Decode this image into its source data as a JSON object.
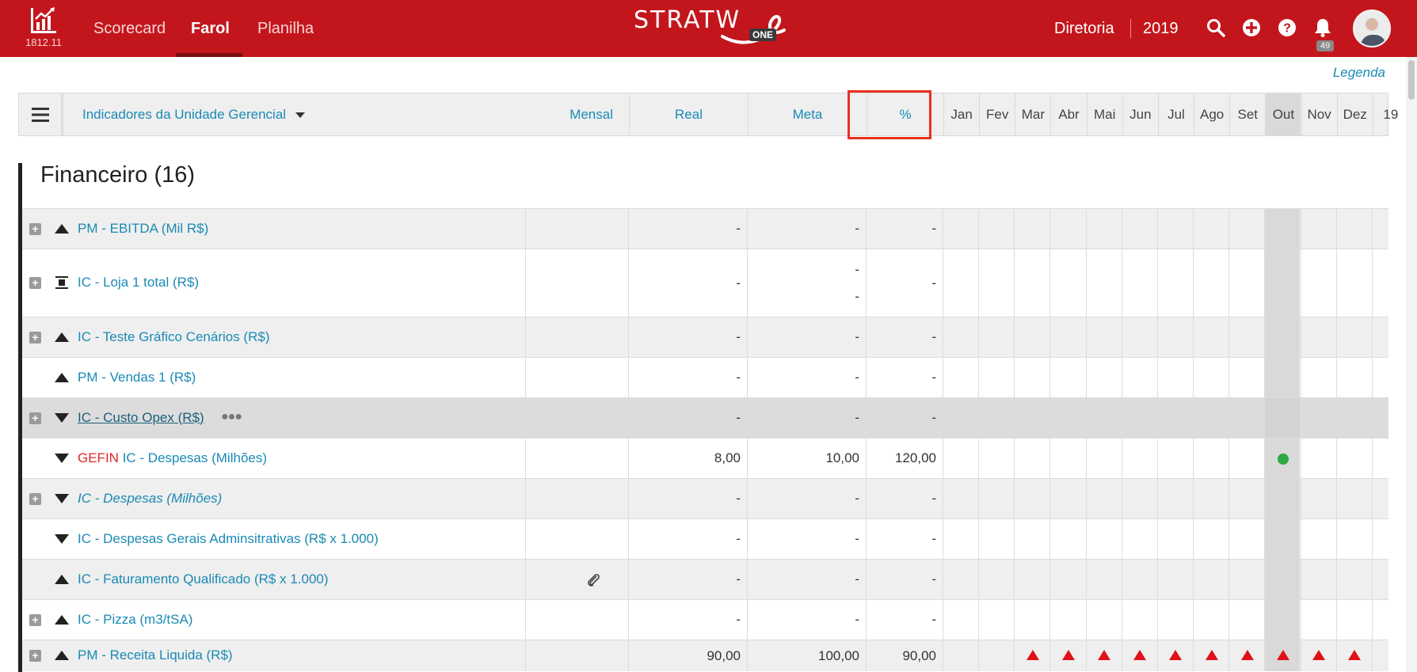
{
  "topbar": {
    "version": "1812.11",
    "nav": [
      "Scorecard",
      "Farol",
      "Planilha"
    ],
    "active_nav": "Farol",
    "brand": "STRATW",
    "brand_badge": "ONE",
    "unit": "Diretoria",
    "year": "2019",
    "notifications": "49",
    "icons": [
      "chart-logo-icon",
      "search-icon",
      "plus-circle-icon",
      "help-circle-icon",
      "bell-icon"
    ]
  },
  "legend_link": "Legenda",
  "header": {
    "selector_label": "Indicadores da Unidade Gerencial",
    "period": "Mensal",
    "real": "Real",
    "meta": "Meta",
    "percent": "%",
    "months": [
      "Jan",
      "Fev",
      "Mar",
      "Abr",
      "Mai",
      "Jun",
      "Jul",
      "Ago",
      "Set",
      "Out",
      "Nov",
      "Dez",
      "19"
    ],
    "current_month": "Out"
  },
  "section": {
    "title": "Financeiro (16)"
  },
  "rows": [
    {
      "expand": true,
      "trend": "up",
      "prefix": "",
      "name": "PM - EBITDA (Mil R$)",
      "real": "-",
      "meta": "-",
      "meta2": "",
      "pct": "-",
      "shade": true
    },
    {
      "expand": true,
      "trend": "flat",
      "prefix": "",
      "name": "IC - Loja 1 total (R$)",
      "real": "-",
      "meta": "-",
      "meta2": "-",
      "pct": "-",
      "shade": false
    },
    {
      "expand": true,
      "trend": "up",
      "prefix": "",
      "name": "IC - Teste Gráfico Cenários (R$)",
      "real": "-",
      "meta": "-",
      "meta2": "",
      "pct": "-",
      "shade": true
    },
    {
      "expand": false,
      "trend": "up",
      "prefix": "",
      "name": "PM - Vendas 1 (R$)",
      "real": "-",
      "meta": "-",
      "meta2": "",
      "pct": "-",
      "shade": false
    },
    {
      "expand": true,
      "trend": "down",
      "prefix": "",
      "name": "IC - Custo Opex (R$) ",
      "real": "-",
      "meta": "-",
      "meta2": "",
      "pct": "-",
      "shade": "dark"
    },
    {
      "expand": false,
      "trend": "down",
      "prefix": "GEFIN",
      "name": "IC - Despesas (Milhões)",
      "real": "8,00",
      "meta": "10,00",
      "meta2": "",
      "pct": "120,00",
      "shade": false,
      "status_out": "green"
    },
    {
      "expand": true,
      "trend": "down",
      "prefix": "",
      "name": "IC - Despesas (Milhões)",
      "real": "-",
      "meta": "-",
      "meta2": "",
      "pct": "-",
      "shade": true,
      "italic": true
    },
    {
      "expand": false,
      "trend": "down",
      "prefix": "",
      "name": "IC - Despesas Gerais Adminsitrativas (R$ x 1.000)",
      "real": "-",
      "meta": "-",
      "meta2": "",
      "pct": "-",
      "shade": false
    },
    {
      "expand": false,
      "trend": "up",
      "prefix": "",
      "name": "IC - Faturamento Qualificado (R$ x 1.000)",
      "real": "-",
      "meta": "-",
      "meta2": "",
      "pct": "-",
      "shade": true,
      "attachment": true
    },
    {
      "expand": true,
      "trend": "up",
      "prefix": "",
      "name": "IC - Pizza (m3/tSA)",
      "real": "-",
      "meta": "-",
      "meta2": "",
      "pct": "-",
      "shade": false
    },
    {
      "expand": true,
      "trend": "up",
      "prefix": "",
      "name": "PM - Receita Liquida (R$)",
      "real": "90,00",
      "meta": "100,00",
      "meta2": "",
      "pct": "90,00",
      "shade": true,
      "red_triangles_months": [
        "Mar",
        "Abr",
        "Mai",
        "Jun",
        "Jul",
        "Ago",
        "Set",
        "Out",
        "Nov",
        "Dez"
      ]
    }
  ],
  "colors": {
    "topbar": "#c3161c",
    "link": "#1a8ab5",
    "highlight_box": "#e8301f",
    "status_green": "#2ea845",
    "status_red": "#e0101a"
  }
}
